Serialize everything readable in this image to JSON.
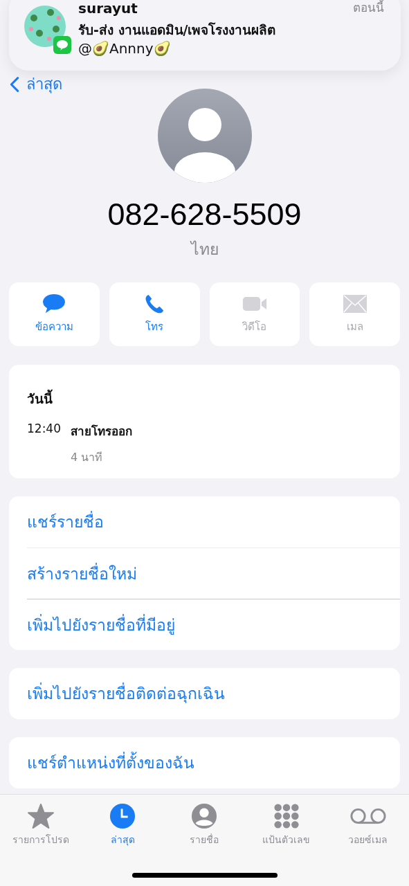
{
  "notification": {
    "title": "surayut",
    "time": "ตอนนี้",
    "message": "รับ-ส่ง งานแอดมิน/เพจโรงงานผลิต",
    "sender": "@🥑Annny🥑"
  },
  "back": {
    "label": "ล่าสุด"
  },
  "contact": {
    "number": "082-628-5509",
    "country": "ไทย"
  },
  "actions": [
    {
      "kind": "message",
      "label": "ข้อความ",
      "disabled": false
    },
    {
      "kind": "call",
      "label": "โทร",
      "disabled": false
    },
    {
      "kind": "video",
      "label": "วิดีโอ",
      "disabled": true
    },
    {
      "kind": "mail",
      "label": "เมล",
      "disabled": true
    }
  ],
  "recents": {
    "day": "วันนี้",
    "entries": [
      {
        "time": "12:40",
        "type": "สายโทรออก",
        "duration": "4 นาที"
      }
    ]
  },
  "option_groups": [
    [
      "แชร์รายชื่อ",
      "สร้างรายชื่อใหม่",
      "เพิ่มไปยังรายชื่อที่มีอยู่"
    ],
    [
      "เพิ่มไปยังรายชื่อติดต่อฉุกเฉิน"
    ],
    [
      "แชร์ตำแหน่งที่ตั้งของฉัน"
    ]
  ],
  "tabs": [
    {
      "kind": "star",
      "label": "รายการโปรด",
      "selected": false
    },
    {
      "kind": "clock",
      "label": "ล่าสุด",
      "selected": true
    },
    {
      "kind": "person",
      "label": "รายชื่อ",
      "selected": false
    },
    {
      "kind": "keypad",
      "label": "แป้นตัวเลข",
      "selected": false
    },
    {
      "kind": "voicemail",
      "label": "วอยซ์เมล",
      "selected": false
    }
  ]
}
